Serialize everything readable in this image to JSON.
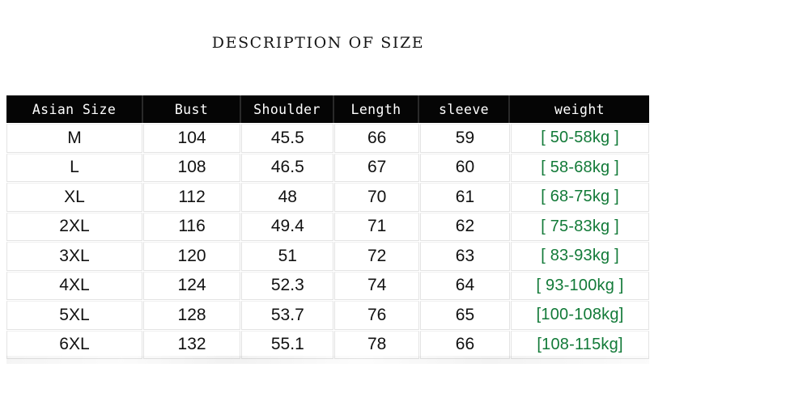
{
  "title": "DESCRIPTION OF SIZE",
  "colors": {
    "header_background": "#050505",
    "header_text": "#ffffff",
    "cell_text": "#111111",
    "weight_text": "#127a38",
    "page_background": "#ffffff"
  },
  "table": {
    "columns": [
      {
        "key": "size",
        "label": "Asian Size"
      },
      {
        "key": "bust",
        "label": "Bust"
      },
      {
        "key": "shoulder",
        "label": "Shoulder"
      },
      {
        "key": "length",
        "label": "Length"
      },
      {
        "key": "sleeve",
        "label": "sleeve"
      },
      {
        "key": "weight",
        "label": "weight"
      }
    ],
    "rows": [
      {
        "size": "M",
        "bust": "104",
        "shoulder": "45.5",
        "length": "66",
        "sleeve": "59",
        "weight": "[ 50-58kg ]"
      },
      {
        "size": "L",
        "bust": "108",
        "shoulder": "46.5",
        "length": "67",
        "sleeve": "60",
        "weight": "[ 58-68kg ]"
      },
      {
        "size": "XL",
        "bust": "112",
        "shoulder": "48",
        "length": "70",
        "sleeve": "61",
        "weight": "[ 68-75kg ]"
      },
      {
        "size": "2XL",
        "bust": "116",
        "shoulder": "49.4",
        "length": "71",
        "sleeve": "62",
        "weight": "[ 75-83kg ]"
      },
      {
        "size": "3XL",
        "bust": "120",
        "shoulder": "51",
        "length": "72",
        "sleeve": "63",
        "weight": "[ 83-93kg ]"
      },
      {
        "size": "4XL",
        "bust": "124",
        "shoulder": "52.3",
        "length": "74",
        "sleeve": "64",
        "weight": "[ 93-100kg ]"
      },
      {
        "size": "5XL",
        "bust": "128",
        "shoulder": "53.7",
        "length": "76",
        "sleeve": "65",
        "weight": "[100-108kg]"
      },
      {
        "size": "6XL",
        "bust": "132",
        "shoulder": "55.1",
        "length": "78",
        "sleeve": "66",
        "weight": "[108-115kg]"
      }
    ]
  }
}
